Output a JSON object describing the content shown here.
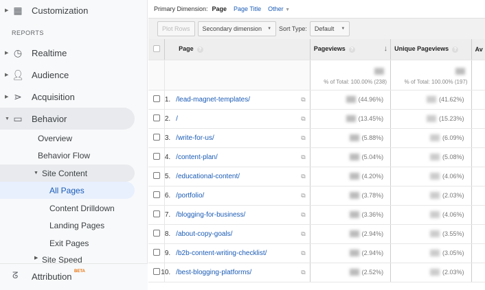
{
  "sidebar": {
    "customization": "Customization",
    "reports_heading": "REPORTS",
    "items": [
      {
        "label": "Realtime"
      },
      {
        "label": "Audience"
      },
      {
        "label": "Acquisition"
      },
      {
        "label": "Behavior"
      }
    ],
    "behavior_sub": [
      "Overview",
      "Behavior Flow",
      "Site Content"
    ],
    "site_content_sub": [
      "All Pages",
      "Content Drilldown",
      "Landing Pages",
      "Exit Pages"
    ],
    "site_speed": "Site Speed",
    "attribution": "Attribution",
    "beta": "BETA"
  },
  "topbar": {
    "primary_dimension_label": "Primary Dimension:",
    "page": "Page",
    "page_title": "Page Title",
    "other": "Other"
  },
  "toolbar": {
    "plot_rows": "Plot Rows",
    "secondary_dimension": "Secondary dimension",
    "sort_type_label": "Sort Type:",
    "sort_type_value": "Default"
  },
  "table": {
    "headers": {
      "page": "Page",
      "pageviews": "Pageviews",
      "unique_pageviews": "Unique Pageviews",
      "next": "Av"
    },
    "totals": {
      "pageviews": "% of Total: 100.00% (238)",
      "unique_pageviews": "% of Total: 100.00% (197)"
    },
    "rows": [
      {
        "n": "1.",
        "page": "/lead-magnet-templates/",
        "pv_pct": "(44.96%)",
        "upv_pct": "(41.62%)"
      },
      {
        "n": "2.",
        "page": "/",
        "pv_pct": "(13.45%)",
        "upv_pct": "(15.23%)"
      },
      {
        "n": "3.",
        "page": "/write-for-us/",
        "pv_pct": "(5.88%)",
        "upv_pct": "(6.09%)"
      },
      {
        "n": "4.",
        "page": "/content-plan/",
        "pv_pct": "(5.04%)",
        "upv_pct": "(5.08%)"
      },
      {
        "n": "5.",
        "page": "/educational-content/",
        "pv_pct": "(4.20%)",
        "upv_pct": "(4.06%)"
      },
      {
        "n": "6.",
        "page": "/portfolio/",
        "pv_pct": "(3.78%)",
        "upv_pct": "(2.03%)"
      },
      {
        "n": "7.",
        "page": "/blogging-for-business/",
        "pv_pct": "(3.36%)",
        "upv_pct": "(4.06%)"
      },
      {
        "n": "8.",
        "page": "/about-copy-goals/",
        "pv_pct": "(2.94%)",
        "upv_pct": "(3.55%)"
      },
      {
        "n": "9.",
        "page": "/b2b-content-writing-checklist/",
        "pv_pct": "(2.94%)",
        "upv_pct": "(3.05%)"
      },
      {
        "n": "10.",
        "page": "/best-blogging-platforms/",
        "pv_pct": "(2.52%)",
        "upv_pct": "(2.03%)"
      }
    ]
  },
  "colors": {
    "link": "#1a5bb5",
    "active_bg": "#e8f0fe",
    "beta": "#e8710a"
  }
}
